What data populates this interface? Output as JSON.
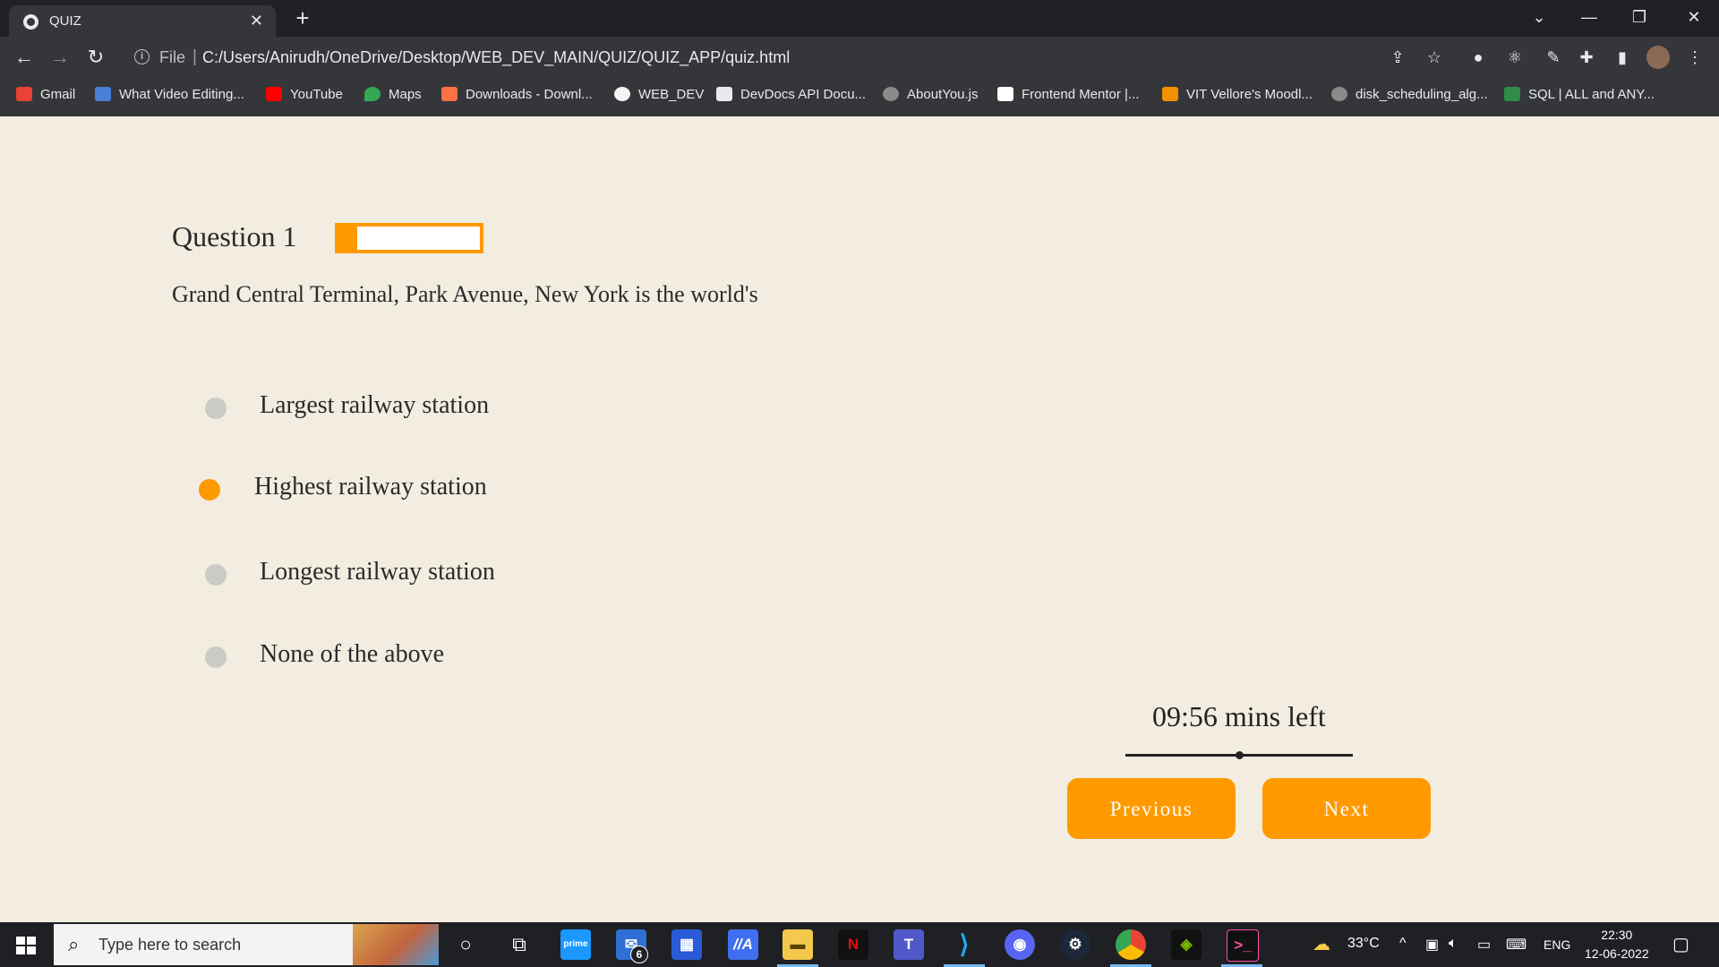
{
  "browser": {
    "tab_title": "QUIZ",
    "address_prefix": "File",
    "url": "C:/Users/Anirudh/OneDrive/Desktop/WEB_DEV_MAIN/QUIZ/QUIZ_APP/quiz.html",
    "bookmarks": [
      {
        "label": "Gmail",
        "color": "#ea4335"
      },
      {
        "label": "What Video Editing...",
        "color": "#4a7fd6"
      },
      {
        "label": "YouTube",
        "color": "#ff0000"
      },
      {
        "label": "Maps",
        "color": "#34a853"
      },
      {
        "label": "Downloads - Downl...",
        "color": "#ff7043"
      },
      {
        "label": "WEB_DEV",
        "color": "#f5f5f5"
      },
      {
        "label": "DevDocs API Docu...",
        "color": "#e8eaed"
      },
      {
        "label": "AboutYou.js",
        "color": "#8a8a8a"
      },
      {
        "label": "Frontend Mentor |...",
        "color": "#ffffff"
      },
      {
        "label": "VIT Vellore's Moodl...",
        "color": "#f29100"
      },
      {
        "label": "disk_scheduling_alg...",
        "color": "#8a8a8a"
      },
      {
        "label": "SQL | ALL and ANY...",
        "color": "#2f8d46"
      }
    ]
  },
  "quiz": {
    "question_title": "Question 1",
    "progress": 0.1,
    "question_text": "Grand Central Terminal, Park Avenue, New York is the world's",
    "options": [
      {
        "label": "Largest railway station",
        "selected": false
      },
      {
        "label": "Highest railway station",
        "selected": true
      },
      {
        "label": "Longest railway station",
        "selected": false
      },
      {
        "label": "None of the above",
        "selected": false
      }
    ],
    "timer_text": "09:56 mins left",
    "previous_label": "Previous",
    "next_label": "Next",
    "accent_color": "#ff9900"
  },
  "taskbar": {
    "search_placeholder": "Type here to search",
    "mail_badge": "6",
    "temperature": "33°C",
    "language": "ENG",
    "time": "22:30",
    "date": "12-06-2022"
  }
}
